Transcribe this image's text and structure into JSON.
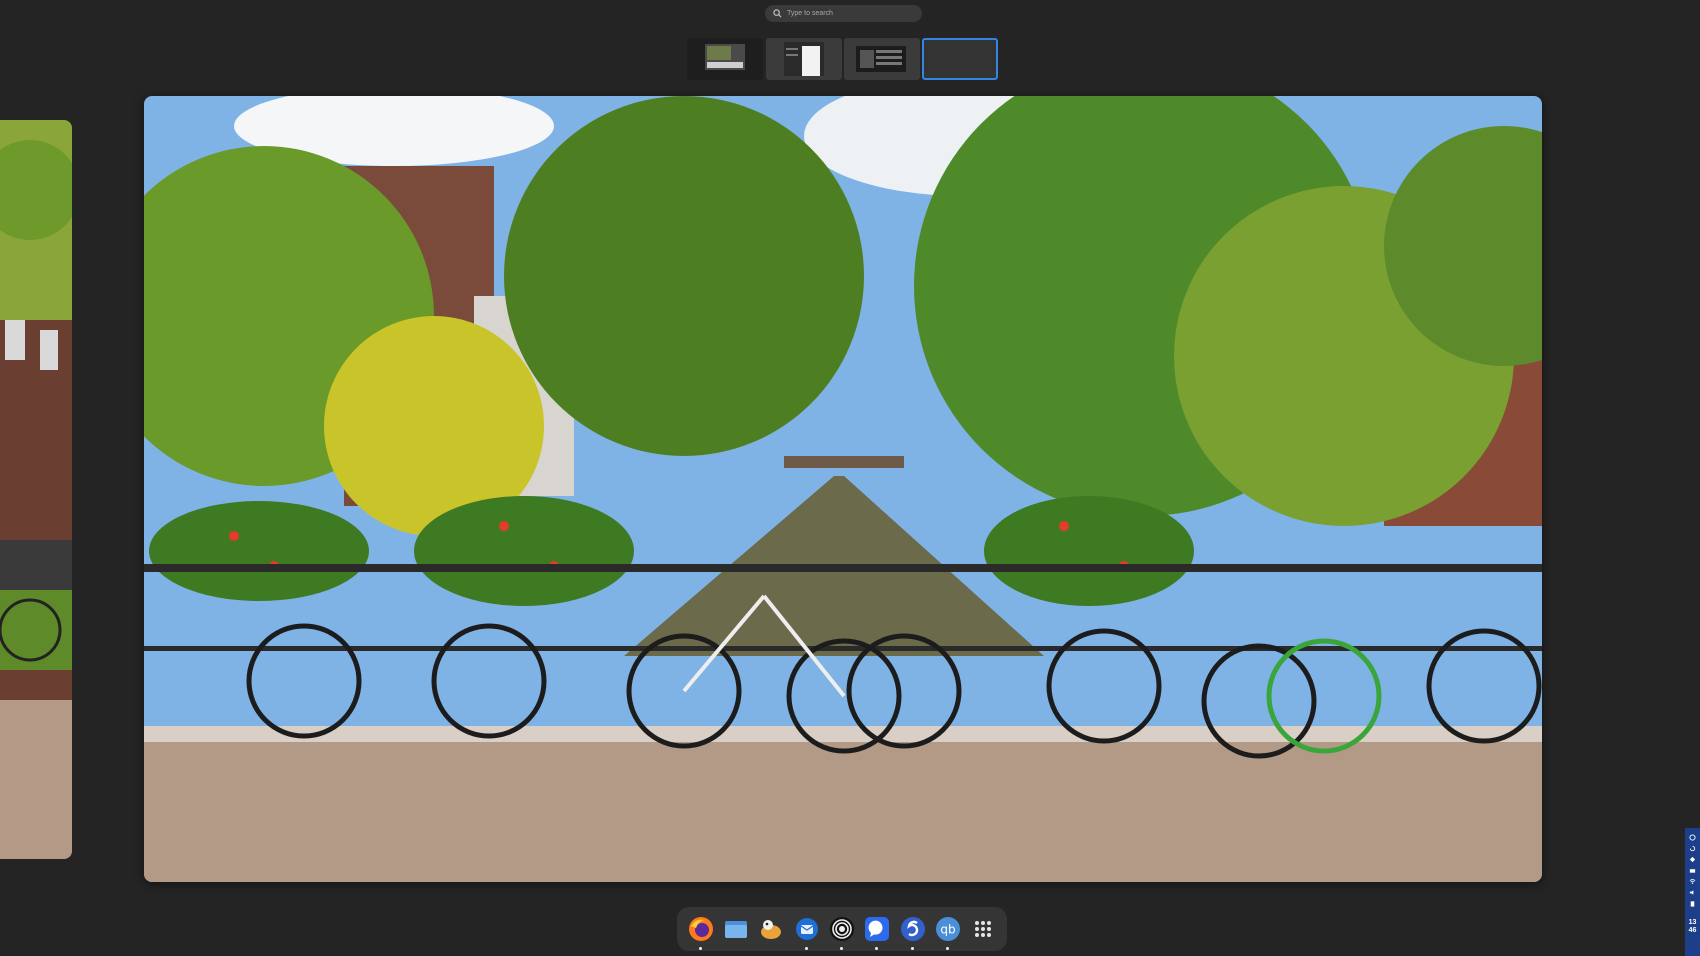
{
  "search": {
    "placeholder": "Type to search"
  },
  "workspaces": [
    {
      "label": "Workspace 1",
      "active": false
    },
    {
      "label": "Workspace 2",
      "active": false
    },
    {
      "label": "Workspace 3",
      "active": false
    },
    {
      "label": "Workspace 4",
      "active": true
    }
  ],
  "dock": {
    "apps": [
      {
        "name": "Firefox",
        "icon": "firefox-icon",
        "running": true
      },
      {
        "name": "Files",
        "icon": "folder-icon",
        "running": false
      },
      {
        "name": "Gajim",
        "icon": "duck-icon",
        "running": false
      },
      {
        "name": "Thunderbird",
        "icon": "thunderbird-icon",
        "running": true
      },
      {
        "name": "Screen Recorder",
        "icon": "record-icon",
        "running": true
      },
      {
        "name": "Signal",
        "icon": "chat-bubble-icon",
        "running": true
      },
      {
        "name": "Simplenote",
        "icon": "s-logo-icon",
        "running": true
      },
      {
        "name": "qBittorrent",
        "icon": "qb-icon",
        "running": true
      },
      {
        "name": "Show Apps",
        "icon": "app-grid-icon",
        "running": false
      }
    ],
    "qb_label": "qb"
  },
  "tray": {
    "clock_hour": "13",
    "clock_minute": "46"
  },
  "colors": {
    "accent": "#3584e4",
    "background": "#242424",
    "dock": "#353535",
    "tray": "#1d3f8a"
  }
}
